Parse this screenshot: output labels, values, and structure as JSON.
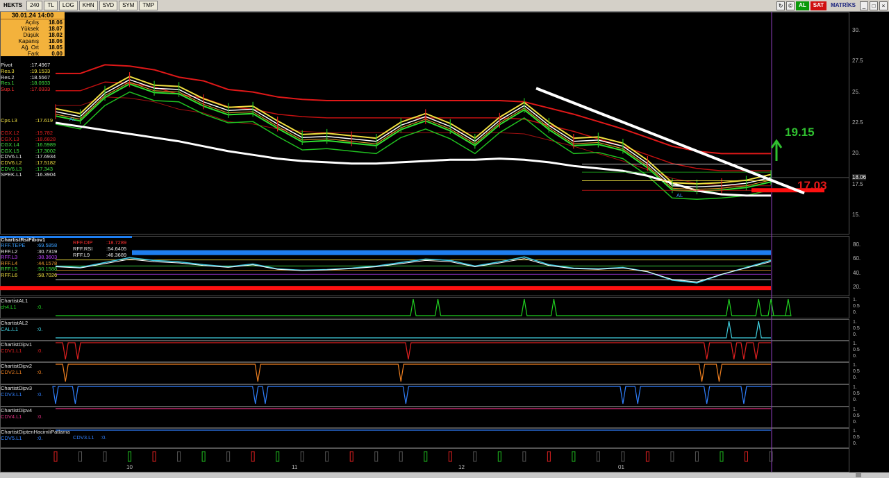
{
  "toolbar": {
    "symbol": "HEKTS",
    "period": "240",
    "currency": "TL",
    "buttons": [
      "LOG",
      "KHN",
      "SVD",
      "SYM",
      "TMP"
    ],
    "al_label": "AL",
    "sat_label": "SAT",
    "matriks_label": "MATRİKS"
  },
  "info": {
    "date": "30.01.24 14:00",
    "rows": [
      {
        "label": "Açılış",
        "value": "18.06"
      },
      {
        "label": "Yüksek",
        "value": "18.07"
      },
      {
        "label": "Düşük",
        "value": "18.02"
      },
      {
        "label": "Kapanış",
        "value": "18.06"
      },
      {
        "label": "Ağ. Ort",
        "value": "18.05"
      },
      {
        "label": "Fark",
        "value": "0.00"
      }
    ]
  },
  "main_labels": [
    {
      "name": "Pivot",
      "value": ":17.4967",
      "color": "#e8e8e8"
    },
    {
      "name": "Res.3",
      "value": ":19.1533",
      "color": "#f0e040"
    },
    {
      "name": "Res.2",
      "value": ":18.5567",
      "color": "#e8e8e8"
    },
    {
      "name": "Res.1",
      "value": ":18.0933",
      "color": "#40e040"
    },
    {
      "name": "Sup.1",
      "value": ":17.0333",
      "color": "#ff3030"
    }
  ],
  "cps_label": {
    "name": "Cps.L3",
    "value": ":17.619",
    "color": "#f0e040"
  },
  "lower_labels": [
    {
      "name": "CGX.L2",
      "value": ":19.782",
      "color": "#e02020"
    },
    {
      "name": "CGX.L3",
      "value": ":18.6828",
      "color": "#e02020"
    },
    {
      "name": "CGX.L4",
      "value": ":16.5989",
      "color": "#40e040"
    },
    {
      "name": "CGX.L5",
      "value": ":17.3002",
      "color": "#40e040"
    },
    {
      "name": "CDV6.L1",
      "value": ":17.6934",
      "color": "#e8e8e8"
    },
    {
      "name": "CDV6.L2",
      "value": ":17.5182",
      "color": "#f0e040"
    },
    {
      "name": "CDV6.L3",
      "value": ":17.343",
      "color": "#40e040"
    },
    {
      "name": "SPEK.L1",
      "value": ":16.3904",
      "color": "#e8e8e8"
    }
  ],
  "annotations": {
    "target_up": "19.15",
    "target_down": "17.03",
    "al_marker": "AL"
  },
  "price_axis": {
    "ticks": [
      "30.",
      "27.5",
      "25.",
      "22.5",
      "20.",
      "17.5",
      "15."
    ],
    "current": "18.06",
    "ylim": [
      13.5,
      31.5
    ]
  },
  "x_axis": {
    "ticks": [
      "10",
      "11",
      "12",
      "01"
    ]
  },
  "rsi_panel": {
    "title": "ChartistRsiFibov1",
    "left_labels": [
      {
        "name": "RFF.TEPE",
        "value": ":69.5858",
        "color": "#3aa0ff"
      },
      {
        "name": "RFF.L2",
        "value": ":30.7319",
        "color": "#e8e8e8"
      },
      {
        "name": "RFF.L3",
        "value": ":38.3603",
        "color": "#c040ff"
      },
      {
        "name": "RFF.L4",
        "value": ":44.1578",
        "color": "#f0a030"
      },
      {
        "name": "RFF.L5",
        "value": ":50.1588",
        "color": "#40e040"
      },
      {
        "name": "RFF.L6",
        "value": ":58.7026",
        "color": "#f0e040"
      }
    ],
    "mid_labels": [
      {
        "name": "RFF.DIP",
        "value": ":18.7289",
        "color": "#ff3030"
      },
      {
        "name": "RFF.RSI",
        "value": ":54.6405",
        "color": "#e8e8e8"
      },
      {
        "name": "RFF.L9",
        "value": ":46.3689",
        "color": "#e8e8e8"
      }
    ],
    "ticks": [
      "80.",
      "60.",
      "40.",
      "20."
    ]
  },
  "sub_panels": [
    {
      "title": "ChartistAL1",
      "line_name": "ch4.L1",
      "line_value": ":0.",
      "color": "#20d020"
    },
    {
      "title": "ChartistAL2",
      "line_name": "CAL.L1",
      "line_value": ":0.",
      "color": "#40d0e0"
    },
    {
      "title": "ChartistDipv1",
      "line_name": "CDV1.L1",
      "line_value": ":0.",
      "color": "#e02020"
    },
    {
      "title": "ChartistDipv2",
      "line_name": "CDV2.L1",
      "line_value": ":0.",
      "color": "#f08020"
    },
    {
      "title": "ChartistDipv3",
      "line_name": "CDV3.L1",
      "line_value": ":0.",
      "color": "#3080ff"
    },
    {
      "title": "ChartistDipv4",
      "line_name": "CDV4.L1",
      "line_value": ":0.",
      "color": "#e03080"
    },
    {
      "title": "ChartistDiptenHacimliPatlama",
      "line_name": "CDV5.L1",
      "line_value": ":0.",
      "color": "#3080ff"
    }
  ],
  "cdv3_extra": {
    "name": "CDV3.L1",
    "value": ":0."
  },
  "sub_ticks": [
    "1.",
    "0.5",
    "0."
  ],
  "colors": {
    "bg": "#000000",
    "resistance": "#e01818",
    "support": "#20c020",
    "ma_white": "#ffffff",
    "fib": "#f0e040",
    "rsi": "#40c8e0",
    "tepe": "#1e7ef0",
    "dip": "#ff1010"
  },
  "chart_data": {
    "type": "line",
    "title": "",
    "xlabel": "",
    "ylabel": "",
    "ylim": [
      13.5,
      31.5
    ],
    "x_ticks": [
      "10",
      "11",
      "12",
      "01"
    ],
    "series": [
      {
        "name": "",
        "values": [
          23.4,
          23.0,
          24.9,
          26.0,
          25.3,
          25.2,
          24.2,
          23.5,
          23.6,
          22.4,
          21.3,
          21.4,
          21.2,
          21.0,
          22.3,
          23.0,
          22.2,
          21.0,
          22.7,
          23.9,
          22.3,
          21.0,
          21.1,
          20.6,
          19.2,
          17.4,
          17.3,
          17.4,
          17.6,
          18.06
        ]
      },
      {
        "name": "",
        "values": [
          22.5,
          22.2,
          21.9,
          21.6,
          21.3,
          21.0,
          20.6,
          20.2,
          19.9,
          19.6,
          19.4,
          19.3,
          19.2,
          19.2,
          19.3,
          19.4,
          19.5,
          19.5,
          19.6,
          19.5,
          19.3,
          19.0,
          18.8,
          18.6,
          18.2,
          17.6,
          17.0,
          16.7,
          16.6,
          16.6
        ]
      },
      {
        "name": "",
        "values": [
          26.5,
          26.5,
          27.2,
          27.1,
          26.8,
          26.2,
          25.9,
          25.2,
          25.0,
          24.6,
          24.4,
          24.3,
          24.3,
          24.3,
          24.3,
          24.3,
          24.3,
          24.3,
          24.3,
          24.2,
          23.7,
          23.2,
          22.6,
          22.0,
          21.3,
          20.6,
          20.2,
          20.0,
          20.0,
          20.0
        ]
      }
    ],
    "trendline": {
      "start": {
        "x": "11.23",
        "y": 25.3
      },
      "end": {
        "x": "01.30",
        "y": 16.8
      }
    },
    "annotations": [
      {
        "text": "19.15",
        "y": 19.15
      },
      {
        "text": "17.03",
        "y": 17.03
      }
    ],
    "rsi": {
      "values": [
        50,
        48,
        55,
        62,
        58,
        56,
        52,
        49,
        53,
        46,
        44,
        45,
        47,
        50,
        55,
        60,
        58,
        50,
        56,
        63,
        52,
        47,
        46,
        48,
        42,
        30,
        26,
        38,
        48,
        58
      ],
      "tepe": 69.5858,
      "dip": 18.7289,
      "ylim": [
        10,
        90
      ]
    },
    "signals": {
      "al1": [
        14.5,
        15.5,
        19.0,
        20.2,
        27.3,
        28.5,
        29.0,
        29.7
      ],
      "al2": [
        27.3,
        28.5
      ],
      "dip1": [
        0.4,
        0.9,
        14.3,
        26.4,
        27.5,
        27.9,
        28.4
      ],
      "dip2": [
        0.4,
        8.2,
        14.0,
        26.2,
        26.9
      ],
      "dip3": [
        0.0,
        0.8,
        8.1,
        8.5,
        14.2,
        23.0,
        23.6,
        26.4,
        27.9
      ],
      "dip4": [],
      "dip5": []
    }
  }
}
